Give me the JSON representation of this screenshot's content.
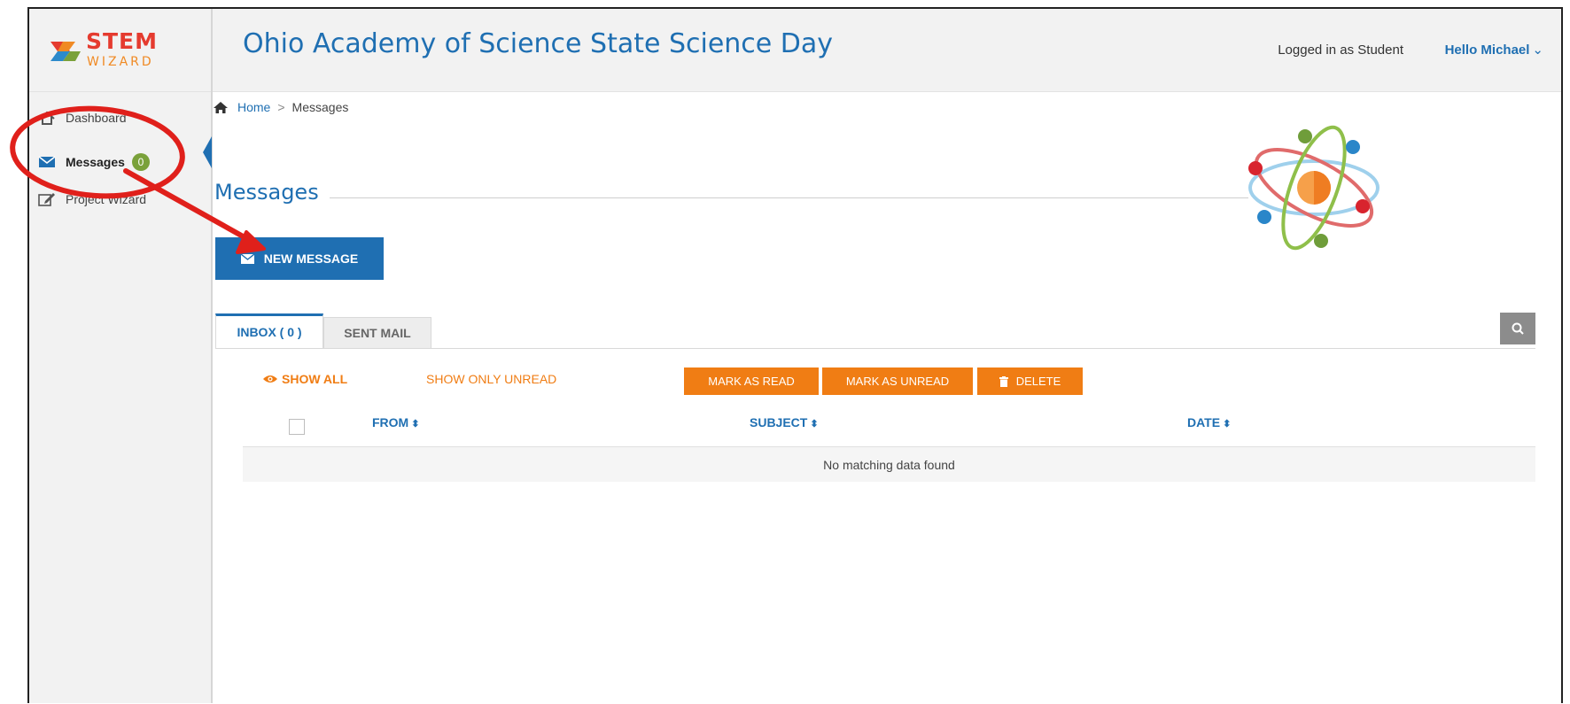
{
  "brand": {
    "logo_top": "STEM",
    "logo_bottom": "WIZARD"
  },
  "header": {
    "title": "Ohio Academy of Science State Science Day",
    "logged_in_text": "Logged in as Student",
    "user_greeting": "Hello Michael",
    "user_menu_icon": "chevron-down-icon"
  },
  "sidebar": {
    "items": [
      {
        "label": "Dashboard",
        "icon": "dashboard-icon"
      },
      {
        "label": "Messages",
        "icon": "envelope-icon",
        "badge": "0",
        "active": true
      },
      {
        "label": "Project Wizard",
        "icon": "edit-icon"
      }
    ]
  },
  "breadcrumb": {
    "home": "Home",
    "separator": ">",
    "current": "Messages"
  },
  "page": {
    "title": "Messages",
    "illustration": "atom-icon"
  },
  "actions": {
    "new_message": "NEW MESSAGE"
  },
  "tabs": [
    {
      "label": "INBOX ( 0 )",
      "active": true
    },
    {
      "label": "SENT MAIL",
      "active": false
    }
  ],
  "filters": {
    "show_all": "SHOW ALL",
    "show_unread": "SHOW ONLY UNREAD"
  },
  "bulk_actions": {
    "mark_read": "MARK AS READ",
    "mark_unread": "MARK AS UNREAD",
    "delete": "DELETE"
  },
  "table": {
    "columns": [
      "FROM",
      "SUBJECT",
      "DATE"
    ],
    "sort_glyph": "⬍",
    "empty_text": "No matching data found"
  },
  "annotation": {
    "color": "#e0201b",
    "shapes": [
      "circle-highlight",
      "arrow"
    ]
  },
  "colors": {
    "primary": "#1f6fb2",
    "accent": "#f07d14",
    "badge": "#7aa13a",
    "annotation": "#e0201b"
  }
}
